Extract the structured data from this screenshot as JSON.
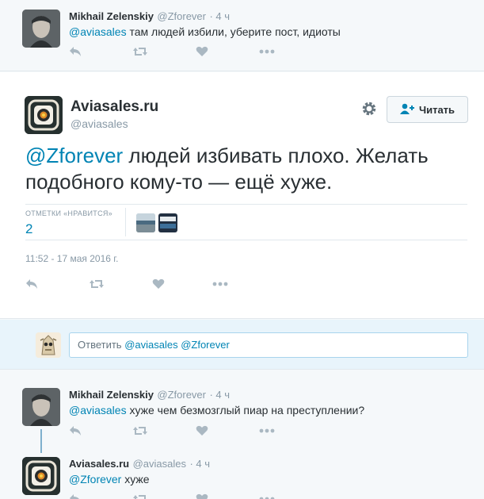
{
  "top_reply": {
    "name": "Mikhail Zelenskiy",
    "handle": "@Zforever",
    "time": "· 4 ч",
    "mention": "@aviasales",
    "text": " там людей избили, уберите пост, идиоты"
  },
  "main_tweet": {
    "name": "Aviasales.ru",
    "handle": "@aviasales",
    "follow_label": "Читать",
    "mention": "@Zforever",
    "text": " людей избивать плохо. Желать подобного кому-то — ещё хуже.",
    "likes_label": "ОТМЕТКИ «НРАВИТСЯ»",
    "likes_count": "2",
    "timestamp": "11:52 - 17 мая 2016 г."
  },
  "reply_box": {
    "prefix": "Ответить ",
    "mentions": "@aviasales @Zforever"
  },
  "thread": [
    {
      "name": "Mikhail Zelenskiy",
      "handle": "@Zforever",
      "time": "· 4 ч",
      "mention": "@aviasales",
      "text": " хуже чем безмозглый пиар на преступлении?"
    },
    {
      "name": "Aviasales.ru",
      "handle": "@aviasales",
      "time": "· 4 ч",
      "mention": "@Zforever",
      "text": " хуже"
    }
  ],
  "icons": {
    "reply": "reply-icon",
    "retweet": "retweet-icon",
    "like": "heart-icon",
    "more": "more-icon",
    "settings": "gear-icon",
    "follow": "add-user-icon"
  },
  "colors": {
    "link": "#0084b4",
    "muted": "#8899a6",
    "action": "#aab8c2",
    "reply_bg": "#e8f4fb"
  }
}
